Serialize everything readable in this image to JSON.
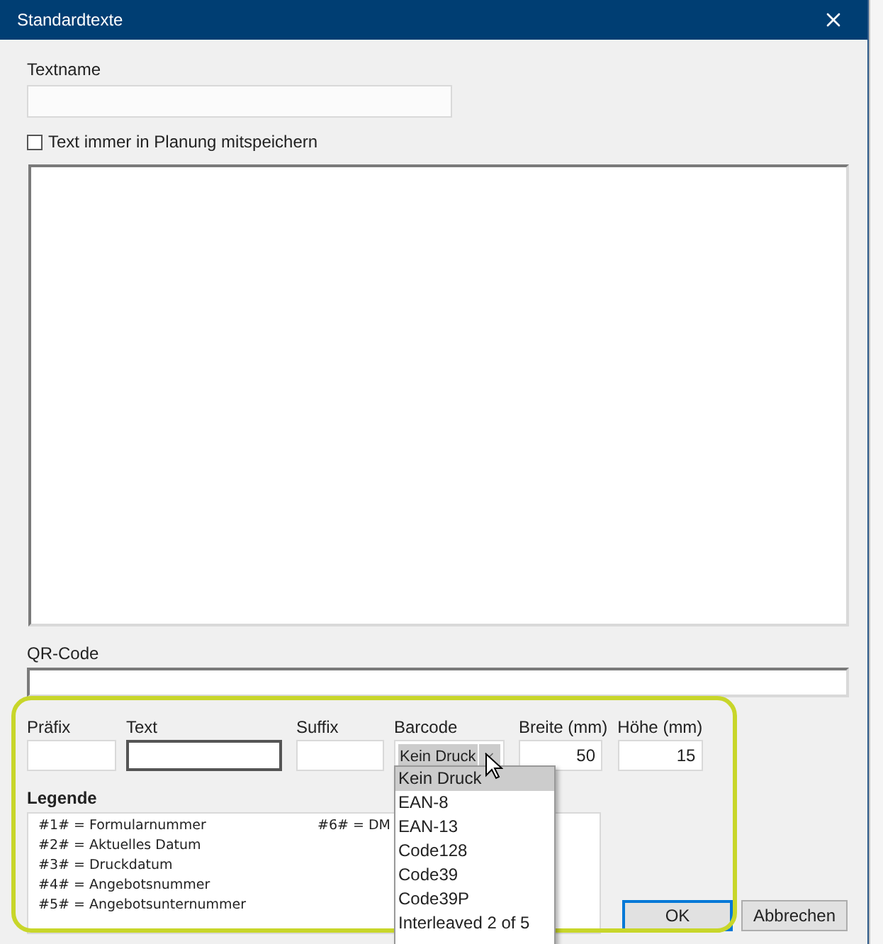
{
  "window": {
    "title": "Standardtexte"
  },
  "textname": {
    "label": "Textname"
  },
  "save_checkbox": {
    "label": "Text immer in Planung mitspeichern",
    "checked": false
  },
  "qr_code": {
    "label": "QR-Code"
  },
  "barcode_fields": [
    {
      "label": "Präfix",
      "kind": "text",
      "focused": false
    },
    {
      "label": "Text",
      "kind": "text",
      "focused": true
    },
    {
      "label": "Suffix",
      "kind": "text",
      "focused": false
    },
    {
      "label": "Barcode",
      "kind": "select",
      "value": "Kein Druck",
      "focused": false
    },
    {
      "label": "Breite (mm)",
      "kind": "number",
      "value": "50",
      "focused": false
    },
    {
      "label": "Höhe (mm)",
      "kind": "number",
      "value": "15",
      "focused": false
    }
  ],
  "legend": {
    "title": "Legende",
    "items": [
      "#1# = Formularnummer",
      "#2# = Aktuelles Datum",
      "#3# = Druckdatum",
      "#4# = Angebotsnummer",
      "#5# = Angebotsunternummer",
      "#6# = DM"
    ]
  },
  "dropdown": {
    "options": [
      {
        "label": "Kein Druck",
        "selected": true
      },
      {
        "label": "EAN-8",
        "selected": false
      },
      {
        "label": "EAN-13",
        "selected": false
      },
      {
        "label": "Code128",
        "selected": false
      },
      {
        "label": "Code39",
        "selected": false
      },
      {
        "label": "Code39P",
        "selected": false
      },
      {
        "label": "Interleaved 2 of 5",
        "selected": false
      }
    ]
  },
  "buttons": [
    {
      "label": "OK",
      "default": true
    },
    {
      "label": "Abbrechen",
      "default": false
    }
  ]
}
